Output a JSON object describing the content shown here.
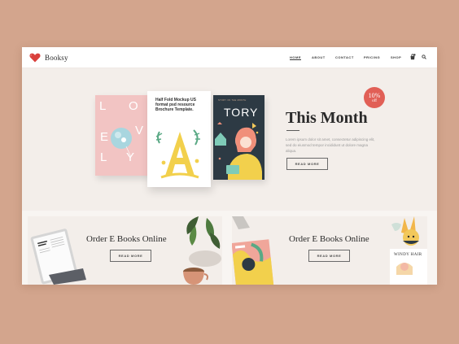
{
  "brand": {
    "name": "Booksy",
    "logo_icon": "heart-icon",
    "logo_color": "#d9403c"
  },
  "nav": {
    "items": [
      "HOME",
      "ABOUT",
      "CONTACT",
      "PRICING",
      "SHOP"
    ],
    "active": "HOME"
  },
  "header_icons": [
    "bag-icon",
    "search-icon"
  ],
  "hero": {
    "title": "This Month",
    "description": "Lorem ipsum dolor sit amet, consectetur adipiscing elit, sed do eiusmod tempor incididunt ut dolore magna aliqua.",
    "button_label": "READ MORE",
    "badge": {
      "value": "10%",
      "label": "off",
      "color": "#e15f56"
    },
    "books": {
      "pink": {
        "lettering": [
          "L",
          "O",
          "V",
          "E",
          "L",
          "Y"
        ]
      },
      "white": {
        "text": "Half Fold Mockup US format psd resource Brochure Template.",
        "letter": "A"
      },
      "dark": {
        "title": "TORY",
        "small": "STORY OF THE MONTH"
      }
    }
  },
  "cards": [
    {
      "title": "Order E Books Online",
      "button_label": "READ MORE"
    },
    {
      "title": "Order E Books Online",
      "button_label": "READ MORE",
      "book_label": "WINDY HAIR"
    }
  ],
  "colors": {
    "background": "#d3a58d",
    "hero_bg": "#f3eeea",
    "accent": "#e15f56"
  }
}
